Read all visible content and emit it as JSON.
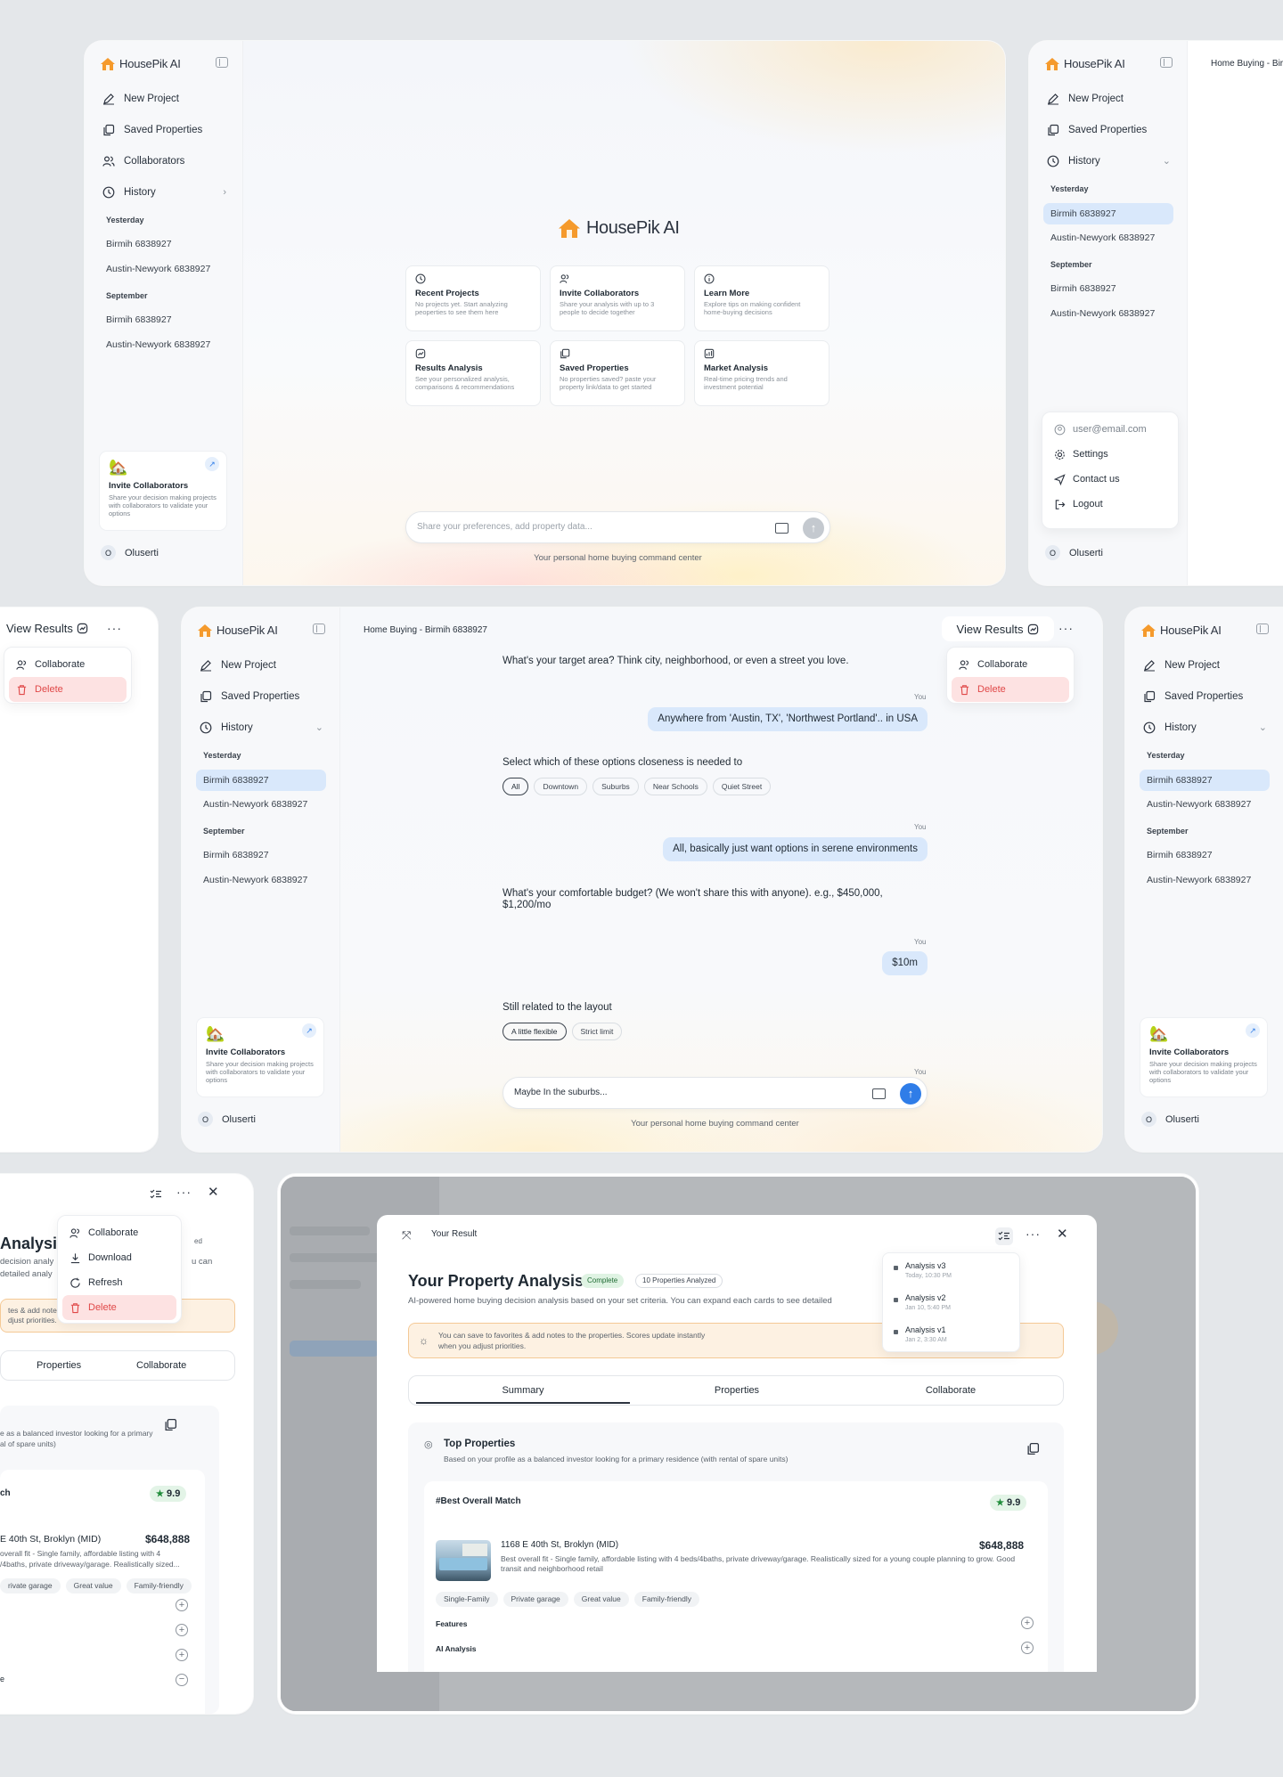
{
  "brand": {
    "name": "HousePik AI",
    "accent": "#f59a2c",
    "primary": "#2f7de8"
  },
  "nav": {
    "new_project": "New Project",
    "saved_properties": "Saved Properties",
    "collaborators": "Collaborators",
    "history": "History"
  },
  "history": {
    "group1": "Yesterday",
    "group2": "September",
    "item1": "Birmih 6838927",
    "item2": "Austin-Newyork 6838927",
    "item3": "Birmih 6838927",
    "item4": "Austin-Newyork 6838927"
  },
  "promo": {
    "title": "Invite Collaborators",
    "desc": "Share your decision making projects with collaborators to validate your options"
  },
  "user": {
    "initial": "O",
    "name": "Oluserti",
    "email": "user@email.com"
  },
  "account_menu": {
    "settings": "Settings",
    "contact": "Contact us",
    "logout": "Logout"
  },
  "home": {
    "logo_text": "HousePik AI",
    "cards": [
      {
        "title": "Recent Projects",
        "desc": "No projects yet. Start analyzing peoperties to see them here",
        "icon": "clock-icon"
      },
      {
        "title": "Invite Collaborators",
        "desc": "Share your analysis with up to 3 people to decide together",
        "icon": "users-icon"
      },
      {
        "title": "Learn More",
        "desc": "Explore tips on making confident home-buying decisions",
        "icon": "info-icon"
      },
      {
        "title": "Results Analysis",
        "desc": "See your personalized analysis, comparisons & recommendations",
        "icon": "chart-icon"
      },
      {
        "title": "Saved Properties",
        "desc": "No properties saved? paste your property link/data to get started",
        "icon": "copy-icon"
      },
      {
        "title": "Market Analysis",
        "desc": "Real-time pricing trends and investment potential",
        "icon": "trend-icon"
      }
    ],
    "input_placeholder": "Share your preferences, add property data...",
    "footnote": "Your personal home buying command center"
  },
  "chat": {
    "header_title": "Home Buying - Birmih 6838927",
    "header_title_cut": "Home Buying - Birm",
    "view_results": "View Results",
    "menu": {
      "collaborate": "Collaborate",
      "delete": "Delete"
    },
    "q1": "What's your target area? Think city, neighborhood, or even a street you love.",
    "you_label": "You",
    "a1": "Anywhere from 'Austin, TX', 'Northwest Portland'.. in USA",
    "q2": "Select which of these options closeness is needed to",
    "options1": [
      "All",
      "Downtown",
      "Suburbs",
      "Near Schools",
      "Quiet Street"
    ],
    "a2": "All, basically just want options in serene environments",
    "q3": "What's your comfortable budget? (We won't share this with anyone). e.g., $450,000, $1,200/mo",
    "a3": "$10m",
    "q4": "Still related to the layout",
    "options2": [
      "A little flexible",
      "Strict limit"
    ],
    "input_value": "Maybe In the suburbs...",
    "footnote": "Your personal home buying command center"
  },
  "results": {
    "modal_title": "Your Result",
    "heading": "Your Property Analysis",
    "heading_cut": "Analysis",
    "status_badge": "Complete",
    "count_badge": "10 Properties Analyzed",
    "count_badge_cut": "ed",
    "subtitle": "AI-powered home buying decision analysis based on your set criteria. You can expand each cards to see detailed",
    "subtitle_cut1": "decision analy",
    "subtitle_cut2": "detailed analy",
    "subtitle_cut3": "u can",
    "notice": "You can save to favorites & add notes to the properties. Scores update instantly when you adjust priorities.",
    "notice_cut1": "tes & add notes",
    "notice_cut2": "djust priorities.",
    "tabs": [
      "Summary",
      "Properties",
      "Collaborate"
    ],
    "versions": [
      {
        "name": "Analysis v3",
        "date": "Today, 10:30 PM"
      },
      {
        "name": "Analysis v2",
        "date": "Jan 10, 5:40 PM"
      },
      {
        "name": "Analysis v1",
        "date": "Jan 2, 3:30 AM"
      }
    ],
    "menu": {
      "collaborate": "Collaborate",
      "download": "Download",
      "refresh": "Refresh",
      "delete": "Delete"
    },
    "top_title": "Top Properties",
    "top_desc": "Based on your profile as a balanced investor looking for a primary residence (with rental of spare units)",
    "top_desc_cut1": "e as a balanced investor looking for a primary",
    "top_desc_cut2": "al of spare units)",
    "best_label": "#Best Overall Match",
    "best_label_cut": "ch",
    "score": "9.9",
    "address": "1168 E 40th St, Broklyn (MID)",
    "address_cut": "E 40th St, Broklyn (MID)",
    "price": "$648,888",
    "description": "Best overall fit - Single family, affordable listing with 4 beds/4baths, private driveway/garage. Realistically sized for a young couple planning to grow. Good transit and neighborhood retail",
    "desc_cut1": "overall fit - Single family, affordable listing with 4",
    "desc_cut2": "/4baths, private driveway/garage. Realistically sized...",
    "tags": [
      "Single-Family",
      "Private garage",
      "Great value",
      "Family-friendly"
    ],
    "tags_cut": [
      "rivate garage",
      "Great value",
      "Family-friendly"
    ],
    "sections": [
      "Features",
      "AI Analysis"
    ],
    "last_cut": "e"
  }
}
